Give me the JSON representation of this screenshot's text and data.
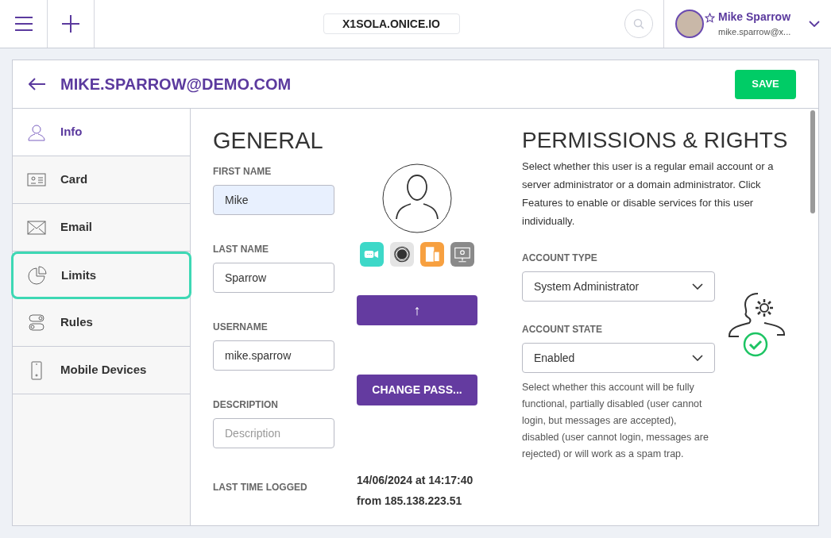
{
  "topbar": {
    "domain": "X1SOLA.ONICE.IO",
    "user": {
      "name": "Mike Sparrow",
      "email": "mike.sparrow@x..."
    }
  },
  "header": {
    "title": "MIKE.SPARROW@DEMO.COM",
    "save": "SAVE"
  },
  "sidebar": {
    "items": [
      {
        "label": "Info",
        "kind": "user",
        "selected": true,
        "focused": false
      },
      {
        "label": "Card",
        "kind": "card",
        "selected": false,
        "focused": false
      },
      {
        "label": "Email",
        "kind": "mail",
        "selected": false,
        "focused": false
      },
      {
        "label": "Limits",
        "kind": "pie",
        "selected": false,
        "focused": true
      },
      {
        "label": "Rules",
        "kind": "toggles",
        "selected": false,
        "focused": false
      },
      {
        "label": "Mobile Devices",
        "kind": "phone",
        "selected": false,
        "focused": false
      }
    ]
  },
  "general": {
    "title": "GENERAL",
    "fields": [
      {
        "label": "FIRST NAME",
        "value": "Mike",
        "highlighted": true
      },
      {
        "label": "LAST NAME",
        "value": "Sparrow",
        "highlighted": false
      },
      {
        "label": "USERNAME",
        "value": "mike.sparrow",
        "highlighted": false
      },
      {
        "label": "DESCRIPTION",
        "placeholder": "Description",
        "highlighted": false
      }
    ],
    "features": [
      {
        "kind": "video"
      },
      {
        "kind": "record"
      },
      {
        "kind": "devices"
      },
      {
        "kind": "desktop"
      }
    ],
    "upload_button": "↑",
    "change_password": "CHANGE PASS...",
    "last_logged": {
      "label": "LAST TIME LOGGED",
      "lines": [
        "14/06/2024 at 14:17:40",
        "from 185.138.223.51"
      ]
    }
  },
  "permissions": {
    "title": "PERMISSIONS & RIGHTS",
    "intro": "Select whether this user is a regular email account or a server administrator or a domain administrator. Click Features to enable or disable services for this user individually.",
    "selects": [
      {
        "label": "ACCOUNT TYPE",
        "value": "System Administrator"
      },
      {
        "label": "ACCOUNT STATE",
        "value": "Enabled"
      }
    ],
    "state_help": "Select whether this account will be fully functional, partially disabled (user cannot login, but messages are accepted), disabled (user cannot login, messages are rejected) or will work as a spam trap."
  }
}
